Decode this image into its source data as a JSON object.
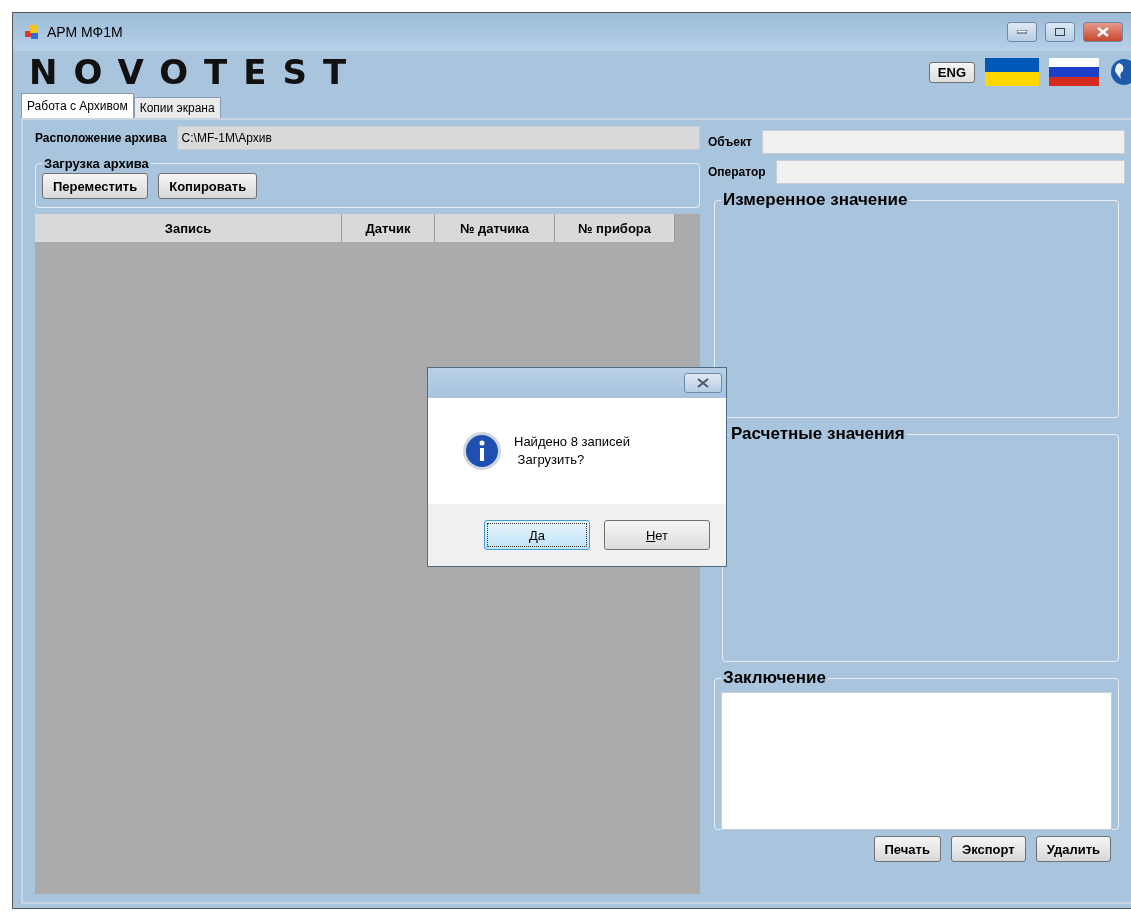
{
  "window": {
    "title": "АРМ МФ1М"
  },
  "header": {
    "logo": "NOVOTEST",
    "language_button": "ENG"
  },
  "tabs": [
    {
      "label": "Работа с Архивом",
      "selected": true
    },
    {
      "label": "Копии экрана",
      "selected": false
    }
  ],
  "archive_location": {
    "label": "Расположение архива",
    "value": "C:\\MF-1M\\Архив"
  },
  "archive_load": {
    "title": "Загрузка архива",
    "buttons": [
      "Переместить",
      "Копировать"
    ]
  },
  "table": {
    "columns": [
      "Запись",
      "Датчик",
      "№ датчика",
      "№ прибора"
    ]
  },
  "object": {
    "label": "Объект"
  },
  "operator": {
    "label": "Оператор"
  },
  "groups": [
    "Измеренное значение",
    "Расчетные значения"
  ],
  "conclusion": {
    "title": "Заключение"
  },
  "bottom_buttons": [
    "Печать",
    "Экспорт",
    "Удалить"
  ],
  "dialog": {
    "lines": [
      "Найдено 8 записей",
      " Загрузить?"
    ],
    "buttons": [
      {
        "label": "Да",
        "focused": true
      },
      {
        "label": "Нет",
        "focused": false
      }
    ]
  }
}
